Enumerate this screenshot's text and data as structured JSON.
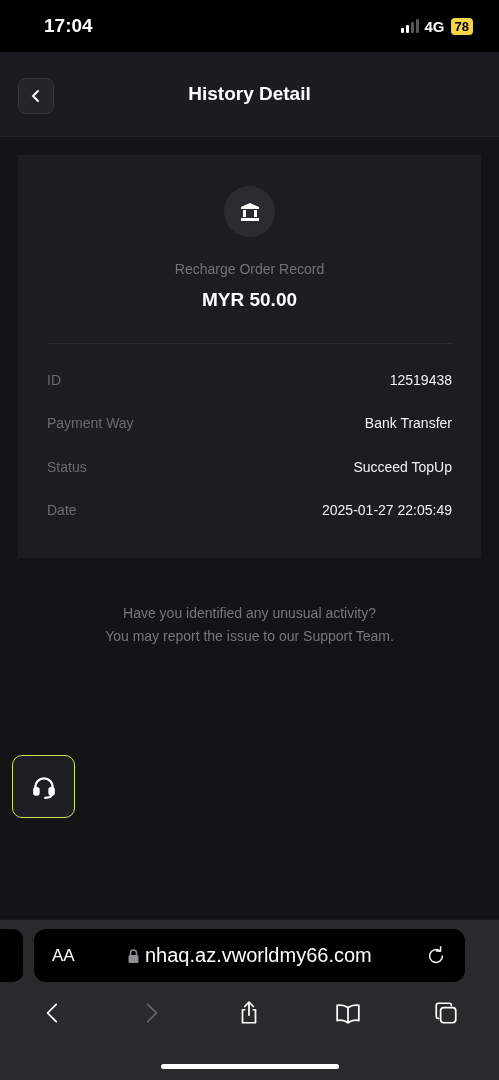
{
  "status_bar": {
    "time": "17:04",
    "network": "4G",
    "battery": "78"
  },
  "header": {
    "title": "History Detail"
  },
  "record": {
    "label": "Recharge Order Record",
    "amount": "MYR 50.00",
    "rows": [
      {
        "label": "ID",
        "value": "12519438"
      },
      {
        "label": "Payment Way",
        "value": "Bank Transfer"
      },
      {
        "label": "Status",
        "value": "Succeed TopUp"
      },
      {
        "label": "Date",
        "value": "2025-01-27 22:05:49"
      }
    ]
  },
  "notice": [
    "Have you identified any unusual activity?",
    "You may report the issue to our Support Team."
  ],
  "browser": {
    "text_size": "AA",
    "url": "nhaq.az.vworldmy66.com",
    "back_disabled": false,
    "forward_disabled": true
  }
}
